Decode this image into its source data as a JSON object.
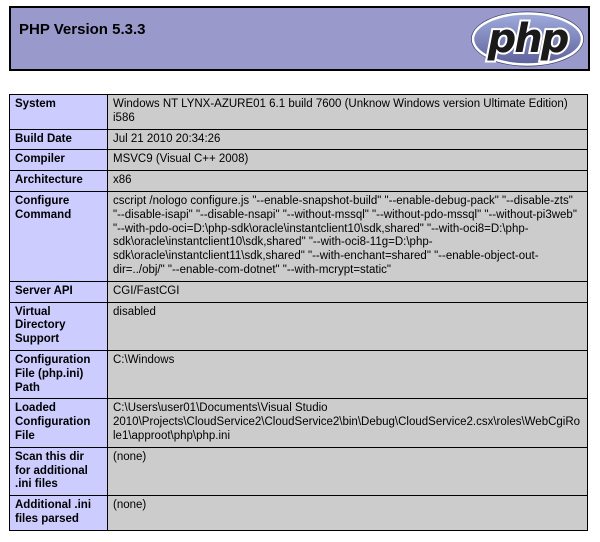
{
  "page": {
    "title": "PHP Version 5.3.3"
  },
  "header": {
    "logo_text": "php"
  },
  "colors": {
    "header_bg": "#9999cc",
    "label_cell_bg": "#ccccff",
    "value_cell_bg": "#cccccc",
    "border": "#000000",
    "logo_fill_top": "#a0abdd",
    "logo_fill_bottom": "#5d629a"
  },
  "info_table": {
    "rows": [
      {
        "label": "System",
        "value": "Windows NT LYNX-AZURE01 6.1 build 7600 (Unknow Windows version Ultimate Edition) i586"
      },
      {
        "label": "Build Date",
        "value": "Jul 21 2010 20:34:26"
      },
      {
        "label": "Compiler",
        "value": "MSVC9 (Visual C++ 2008)"
      },
      {
        "label": "Architecture",
        "value": "x86"
      },
      {
        "label": "Configure Command",
        "value": "cscript /nologo configure.js \"--enable-snapshot-build\" \"--enable-debug-pack\" \"--disable-zts\" \"--disable-isapi\" \"--disable-nsapi\" \"--without-mssql\" \"--without-pdo-mssql\" \"--without-pi3web\" \"--with-pdo-oci=D:\\php-sdk\\oracle\\instantclient10\\sdk,shared\" \"--with-oci8=D:\\php-sdk\\oracle\\instantclient10\\sdk,shared\" \"--with-oci8-11g=D:\\php-sdk\\oracle\\instantclient11\\sdk,shared\" \"--with-enchant=shared\" \"--enable-object-out-dir=../obj/\" \"--enable-com-dotnet\" \"--with-mcrypt=static\""
      },
      {
        "label": "Server API",
        "value": "CGI/FastCGI"
      },
      {
        "label": "Virtual Directory Support",
        "value": "disabled"
      },
      {
        "label": "Configuration File (php.ini) Path",
        "value": "C:\\Windows"
      },
      {
        "label": "Loaded Configuration File",
        "value": "C:\\Users\\user01\\Documents\\Visual Studio 2010\\Projects\\CloudService2\\CloudService2\\bin\\Debug\\CloudService2.csx\\roles\\WebCgiRole1\\approot\\php\\php.ini"
      },
      {
        "label": "Scan this dir for additional .ini files",
        "value": "(none)"
      },
      {
        "label": "Additional .ini files parsed",
        "value": "(none)"
      }
    ]
  }
}
